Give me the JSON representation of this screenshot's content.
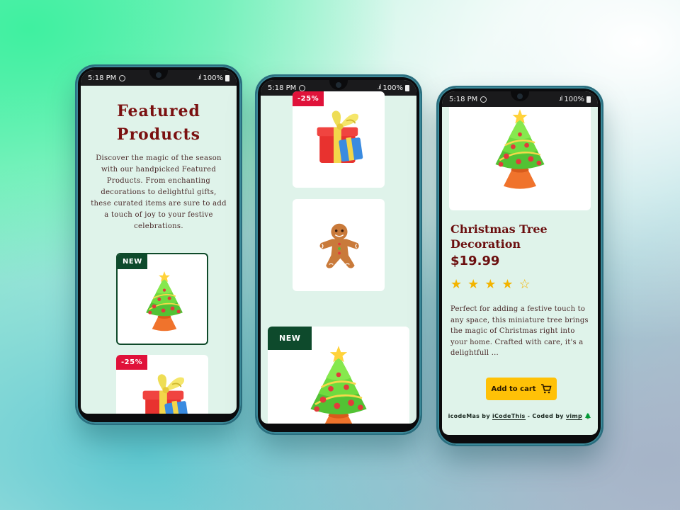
{
  "status": {
    "time": "5:18 PM",
    "battery": "100%"
  },
  "phone1": {
    "title_line1": "Featured",
    "title_line2": "Products",
    "description": "Discover the magic of the season with our handpicked Featured Products. From enchanting decorations to delightful gifts, these curated items are sure to add a touch of joy to your festive celebrations.",
    "cards": [
      {
        "badge": "NEW",
        "image": "christmas-tree"
      },
      {
        "badge": "-25%",
        "image": "gift-box"
      }
    ]
  },
  "phone2": {
    "cards": [
      {
        "badge": "-25%",
        "image": "gift-box"
      },
      {
        "badge": "",
        "image": "gingerbread-man"
      },
      {
        "badge": "NEW",
        "image": "christmas-tree"
      }
    ]
  },
  "phone3": {
    "product_name": "Christmas Tree Decoration",
    "price": "$19.99",
    "rating": {
      "filled": 4,
      "total": 5
    },
    "description": "Perfect for adding a festive touch to any space, this miniature tree brings the magic of Christmas right into your home. Crafted with care, it's a delightfull ...",
    "add_to_cart": "Add to cart",
    "footer": {
      "prefix": "icodeMas by",
      "link1": "iCodeThis",
      "middle": "- Coded by",
      "link2": "vimp",
      "emoji": "🌲"
    }
  },
  "colors": {
    "accent_red": "#7a1010",
    "badge_new": "#0e4a2c",
    "badge_sale": "#e0123a",
    "button": "#ffc107",
    "screen_bg": "#dff3ea"
  }
}
